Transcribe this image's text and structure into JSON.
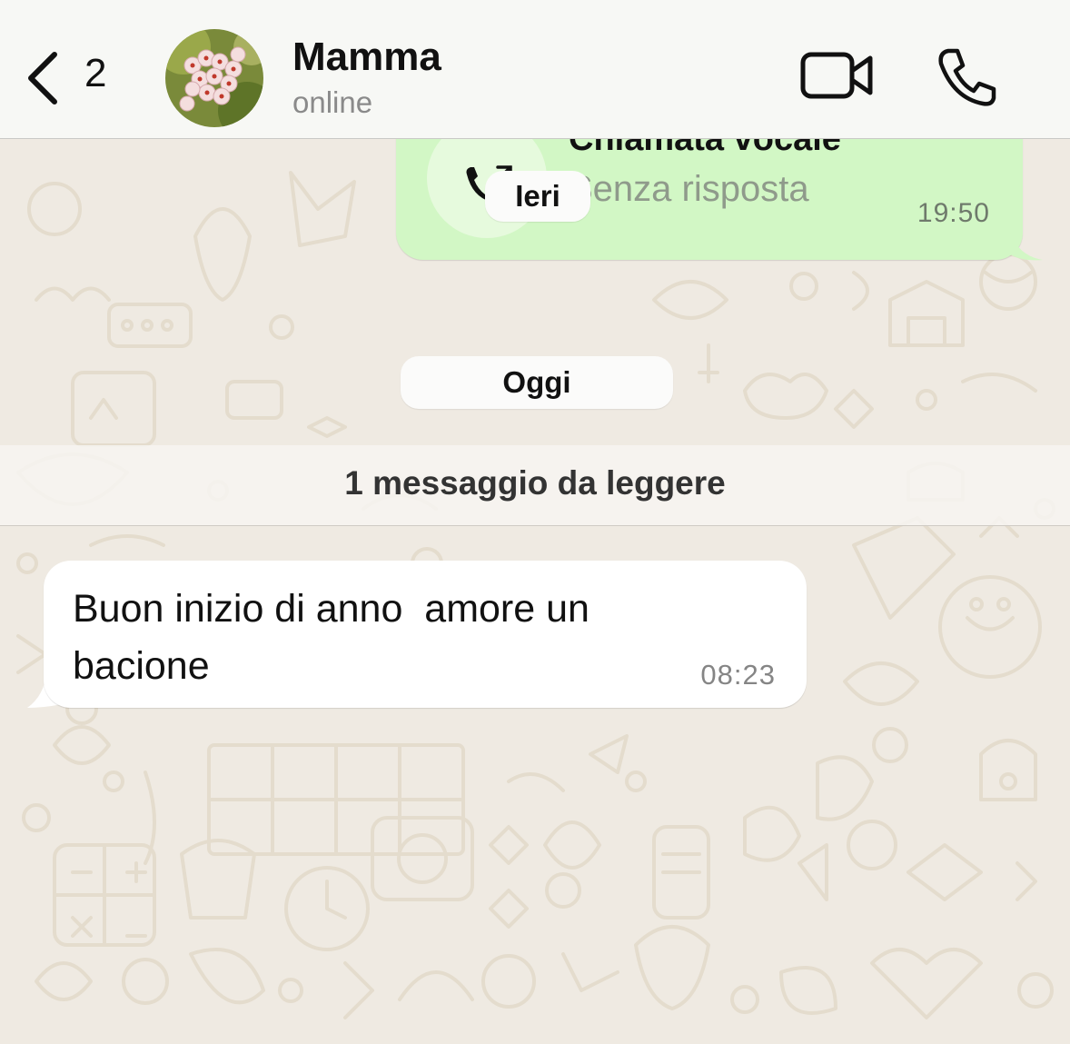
{
  "header": {
    "back_count": "2",
    "contact_name": "Mamma",
    "contact_status": "online"
  },
  "messages": {
    "call": {
      "title": "Chiamata vocale",
      "subtitle": "Senza risposta",
      "time": "19:50"
    },
    "date_ieri": "Ieri",
    "date_oggi": "Oggi",
    "unread_banner": "1 messaggio da leggere",
    "incoming": {
      "text": "Buon inizio di anno  amore un bacione",
      "time": "08:23"
    }
  },
  "colors": {
    "chat_background": "#efeae2",
    "outgoing_bubble": "#d2f7c5",
    "incoming_bubble": "#ffffff",
    "header_background": "#f7f8f5"
  },
  "icons": [
    "chevron-left-icon",
    "video-camera-icon",
    "phone-icon",
    "outgoing-call-icon"
  ]
}
